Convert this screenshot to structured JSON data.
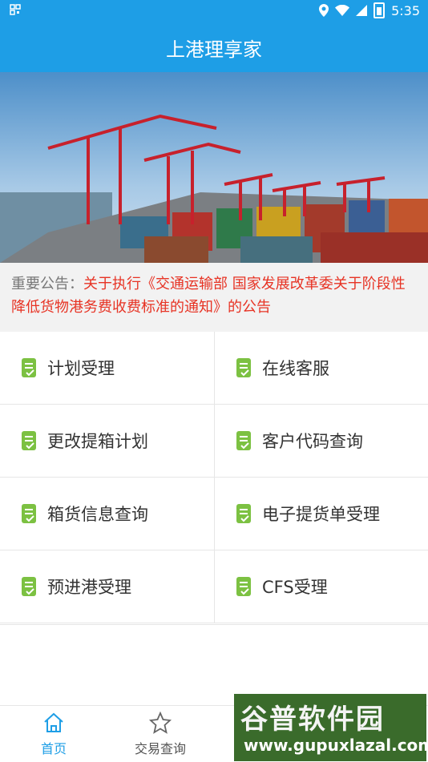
{
  "status_bar": {
    "time": "5:35",
    "left_icon": "qr-scan-icon",
    "right_icons": [
      "location-icon",
      "wifi-icon",
      "signal-icon",
      "battery-icon"
    ]
  },
  "app_bar": {
    "title": "上港理享家"
  },
  "banner": {
    "image": "container-port-cranes-photo"
  },
  "notice": {
    "label": "重要公告：",
    "text": "关于执行《交通运输部 国家发展改革委关于阶段性降低货物港务费收费标准的通知》的公告"
  },
  "menu": {
    "items": [
      {
        "label": "计划受理",
        "icon": "document-check-icon"
      },
      {
        "label": "在线客服",
        "icon": "document-check-icon"
      },
      {
        "label": "更改提箱计划",
        "icon": "document-check-icon"
      },
      {
        "label": "客户代码查询",
        "icon": "document-check-icon"
      },
      {
        "label": "箱货信息查询",
        "icon": "document-check-icon"
      },
      {
        "label": "电子提货单受理",
        "icon": "document-check-icon"
      },
      {
        "label": "预进港受理",
        "icon": "document-check-icon"
      },
      {
        "label": "CFS受理",
        "icon": "document-check-icon"
      }
    ]
  },
  "tab_bar": {
    "tabs": [
      {
        "label": "首页",
        "icon": "home-icon",
        "active": true
      },
      {
        "label": "交易查询",
        "icon": "star-icon",
        "active": false
      }
    ]
  },
  "watermark": {
    "title": "谷普软件园",
    "url": "www.gupuxlazal.com"
  },
  "colors": {
    "primary": "#1e9ee6",
    "notice_red": "#e73324",
    "icon_green": "#7cc142",
    "background": "#ffffff"
  }
}
